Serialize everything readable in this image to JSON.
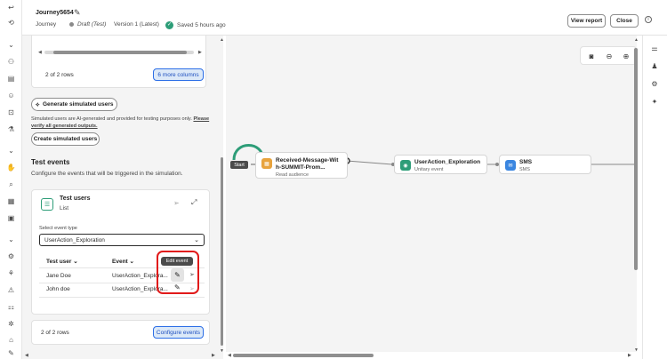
{
  "header": {
    "journey_name": "Journey5654",
    "breadcrumb": "Journey",
    "status": "Draft (Test)",
    "version": "Version 1 (Latest)",
    "saved": "Saved 5 hours ago",
    "view_report_label": "View report",
    "close_label": "Close"
  },
  "left_panel": {
    "rows_top": "2 of 2 rows",
    "more_columns_label": "6 more columns",
    "generate_label": "Generate simulated users",
    "disclaimer_text": "Simulated users are AI-generated and provided for testing purposes only.",
    "disclaimer_link": "Please verify all generated outputs.",
    "create_label": "Create simulated users",
    "test_events_title": "Test events",
    "test_events_desc": "Configure the events that will be triggered in the simulation.",
    "card_title": "Test users",
    "card_subtitle": "List",
    "select_label": "Select event type",
    "select_value": "UserAction_Exploration",
    "table_headers": [
      "Test user",
      "Event"
    ],
    "table_rows": [
      {
        "user": "Jane Doe",
        "event": "UserAction_Explora..."
      },
      {
        "user": "John doe",
        "event": "UserAction_Explora..."
      }
    ],
    "tooltip": "Edit event",
    "rows_bottom": "2 of 2 rows",
    "configure_label": "Configure events"
  },
  "canvas": {
    "start_label": "Start",
    "nodes": [
      {
        "title": "Received-Message-Wit",
        "title2": "h-SUMMIT-Prom...",
        "sub": "Read audience",
        "color": "#e8a33d"
      },
      {
        "title": "UserAction_Exploration",
        "sub": "Unitary event",
        "color": "#2d9d78"
      },
      {
        "title": "SMS",
        "sub": "SMS",
        "color": "#3a86e0"
      }
    ]
  },
  "colors": {
    "accent": "#2c6ee6",
    "success": "#2d9d78",
    "highlight": "#e11a1a",
    "connector": "#2d9d78"
  }
}
